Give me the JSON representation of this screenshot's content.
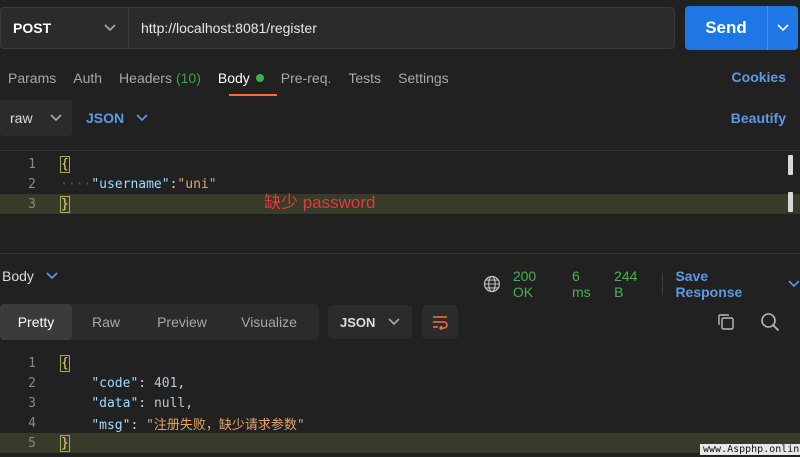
{
  "request": {
    "method": "POST",
    "url": "http://localhost:8081/register",
    "send_label": "Send"
  },
  "req_tabs": [
    {
      "label": "Params"
    },
    {
      "label": "Auth"
    },
    {
      "label": "Headers",
      "count": "(10)"
    },
    {
      "label": "Body"
    },
    {
      "label": "Pre-req."
    },
    {
      "label": "Tests"
    },
    {
      "label": "Settings"
    }
  ],
  "cookies_label": "Cookies",
  "body_mode": "raw",
  "body_format": "JSON",
  "beautify_label": "Beautify",
  "request_body": {
    "line_numbers": [
      "1",
      "2",
      "3"
    ],
    "key": "\"username\"",
    "colon": ":",
    "value": "\"uni\"",
    "open_brace": "{",
    "close_brace": "}"
  },
  "annotation": "缺少 password",
  "response": {
    "section_label": "Body",
    "status": "200 OK",
    "time": "6 ms",
    "size": "244 B",
    "save_label": "Save Response",
    "view_tabs": [
      "Pretty",
      "Raw",
      "Preview",
      "Visualize"
    ],
    "format": "JSON",
    "line_numbers": [
      "1",
      "2",
      "3",
      "4",
      "5"
    ],
    "lines": [
      {
        "key": "\"code\"",
        "value": "401,"
      },
      {
        "key": "\"data\"",
        "value": "null,"
      },
      {
        "key": "\"msg\"",
        "value": "\"注册失败，缺少请求参数\""
      }
    ],
    "open_brace": "{",
    "close_brace": "}"
  },
  "watermark": "www.Aspphp.online",
  "colors": {
    "accent": "#ff6c37",
    "send": "#1f76e5",
    "link": "#5b9ae8",
    "status_ok": "#4cb050"
  }
}
